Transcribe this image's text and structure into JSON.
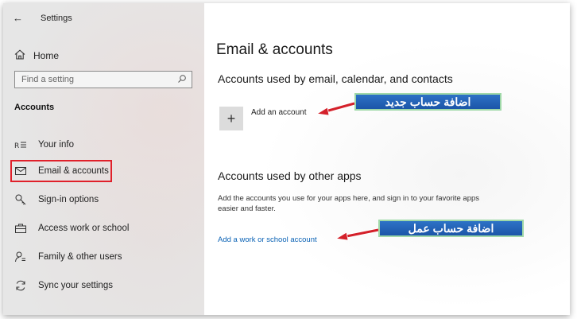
{
  "window": {
    "title": "Settings"
  },
  "sidebar": {
    "home_label": "Home",
    "search_placeholder": "Find a setting",
    "section_title": "Accounts",
    "items": [
      {
        "label": "Your info",
        "icon": "person-card-icon"
      },
      {
        "label": "Email & accounts",
        "icon": "mail-icon",
        "selected": true
      },
      {
        "label": "Sign-in options",
        "icon": "key-icon"
      },
      {
        "label": "Access work or school",
        "icon": "briefcase-icon"
      },
      {
        "label": "Family & other users",
        "icon": "people-icon"
      },
      {
        "label": "Sync your settings",
        "icon": "sync-icon"
      }
    ]
  },
  "main": {
    "title": "Email & accounts",
    "section1_heading": "Accounts used by email, calendar, and contacts",
    "add_account_label": "Add an account",
    "section2_heading": "Accounts used by other apps",
    "section2_desc": "Add the accounts you use for your apps here, and sign in to your favorite apps easier and faster.",
    "add_work_link": "Add a work or school account"
  },
  "annotations": {
    "callout_add_account": "اضافة حساب جديد",
    "callout_work_account": "اضافة حساب عمل",
    "highlight_color": "#e0202a",
    "arrow_color": "#d4202a",
    "callout_bg": "#2563b8"
  }
}
